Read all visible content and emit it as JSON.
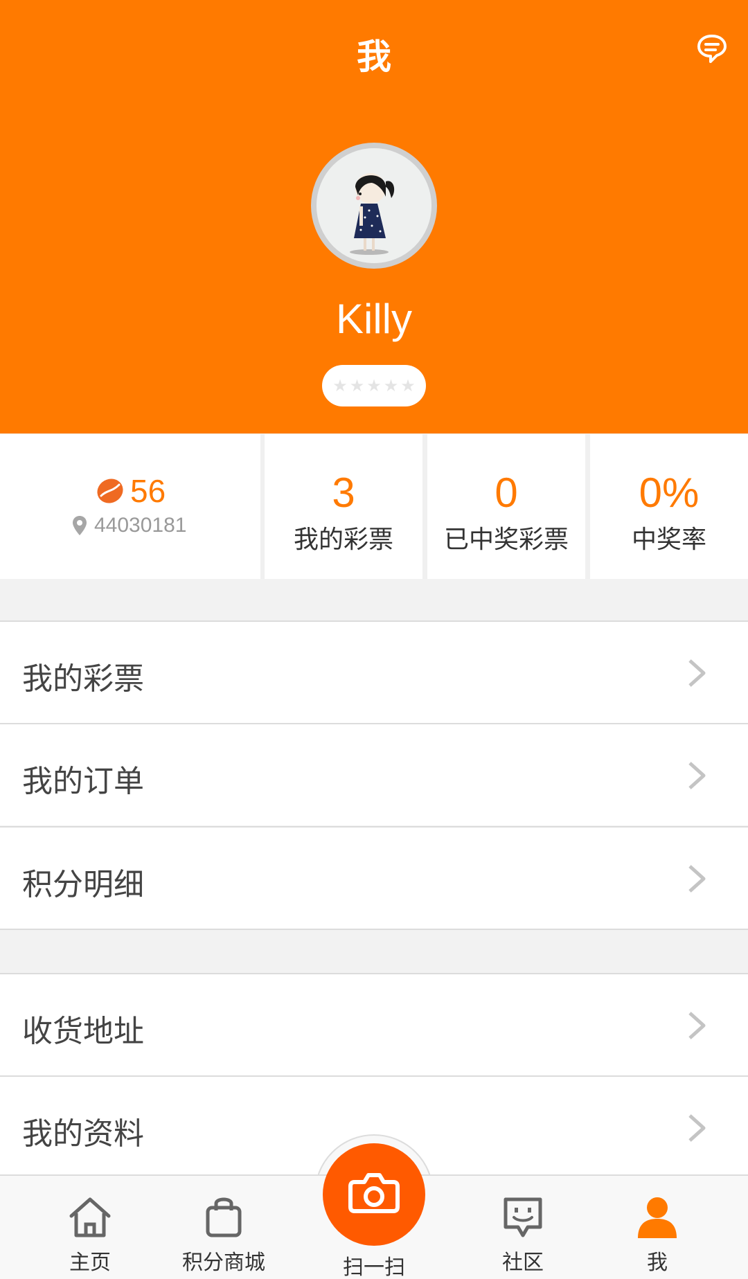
{
  "header": {
    "title": "我",
    "message_icon": "chat-bubble-icon"
  },
  "profile": {
    "username": "Killy",
    "rating_stars": 5,
    "rating_filled": 0
  },
  "stats": {
    "points": "56",
    "location_code": "44030181",
    "items": [
      {
        "value": "3",
        "label": "我的彩票"
      },
      {
        "value": "0",
        "label": "已中奖彩票"
      },
      {
        "value": "0%",
        "label": "中奖率"
      }
    ]
  },
  "menu": {
    "group1": [
      "我的彩票",
      "我的订单",
      "积分明细"
    ],
    "group2": [
      "收货地址",
      "我的资料"
    ]
  },
  "tabbar": {
    "tabs": [
      {
        "label": "主页",
        "icon": "home-icon"
      },
      {
        "label": "积分商城",
        "icon": "shopping-bag-icon"
      },
      {
        "label": "扫一扫",
        "icon": "camera-icon"
      },
      {
        "label": "社区",
        "icon": "community-icon"
      },
      {
        "label": "我",
        "icon": "person-icon"
      }
    ],
    "active": "我"
  },
  "colors": {
    "accent": "#ff7a00",
    "scan": "#ff5a00"
  }
}
